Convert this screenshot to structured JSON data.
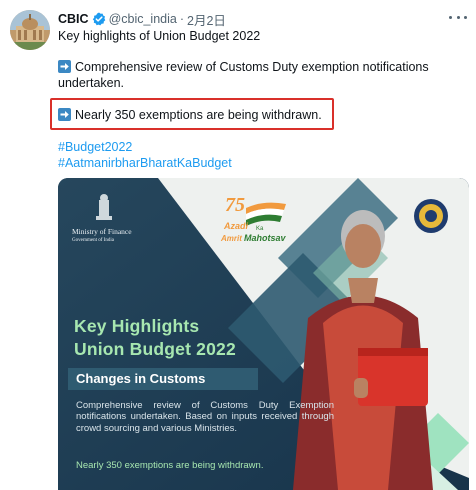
{
  "author": {
    "name": "CBIC",
    "handle": "@cbic_india",
    "separator": "·",
    "date": "2月2日"
  },
  "tweet": {
    "line1": "Key highlights of Union Budget 2022",
    "para2": "Comprehensive review of Customs Duty exemption notifications undertaken.",
    "para3": "Nearly 350 exemptions are being withdrawn.",
    "hashtags": [
      "#Budget2022",
      "#AatmanirbharBharatKaBudget"
    ]
  },
  "media": {
    "ministry_line1": "Ministry of Finance",
    "ministry_line2": "Government of India",
    "logo_75": "75",
    "logo_azadi": "Azadi",
    "logo_ka": "Ka",
    "logo_amrit": "Amrit",
    "logo_mahotsav": "Mahotsav",
    "heading1": "Key Highlights",
    "heading2": "Union Budget 2022",
    "subheading": "Changes in Customs",
    "body": "Comprehensive review of Customs Duty Exemption notifications undertaken. Based on inputs received through crowd sourcing and various Ministries.",
    "footer": "Nearly 350 exemptions are being withdrawn."
  },
  "icons": {
    "verified": "verified-badge-icon",
    "more": "more-dots-icon",
    "bullet": "right-arrow-emoji-icon"
  },
  "colors": {
    "hashtag": "#1d9bf0",
    "highlight_border": "#d9302a",
    "media_bg": "#1f3f55",
    "heading_green": "#a7e7b0"
  }
}
